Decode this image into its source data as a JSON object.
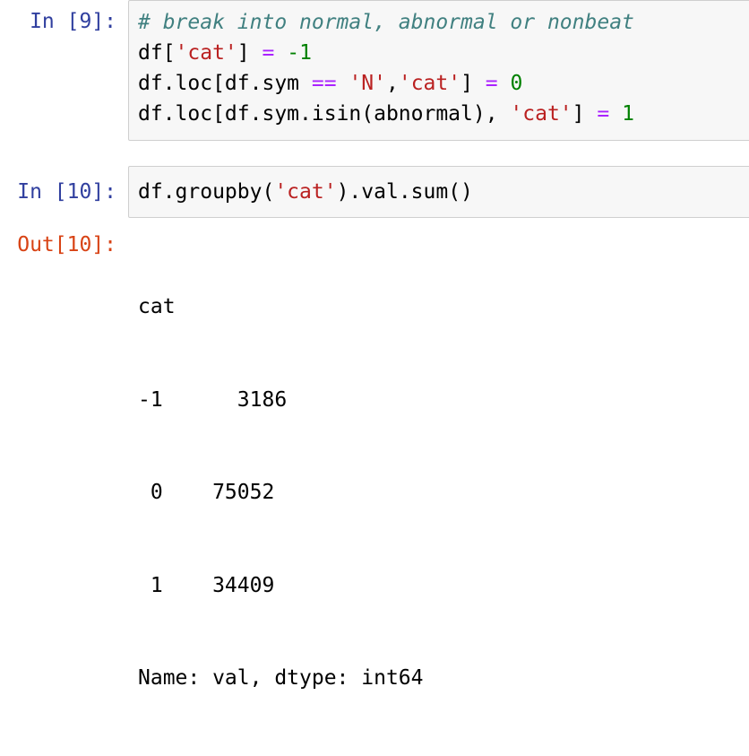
{
  "cells": [
    {
      "prompt": "In [9]:",
      "lines": [
        [
          {
            "t": "# break into normal, abnormal or nonbeat",
            "c": "comment"
          }
        ],
        [
          {
            "t": "df[",
            "c": ""
          },
          {
            "t": "'cat'",
            "c": "str"
          },
          {
            "t": "] ",
            "c": ""
          },
          {
            "t": "=",
            "c": "op"
          },
          {
            "t": " ",
            "c": ""
          },
          {
            "t": "-1",
            "c": "num"
          }
        ],
        [
          {
            "t": "df.loc[df.sym ",
            "c": ""
          },
          {
            "t": "==",
            "c": "op"
          },
          {
            "t": " ",
            "c": ""
          },
          {
            "t": "'N'",
            "c": "str"
          },
          {
            "t": ",",
            "c": ""
          },
          {
            "t": "'cat'",
            "c": "str"
          },
          {
            "t": "] ",
            "c": ""
          },
          {
            "t": "=",
            "c": "op"
          },
          {
            "t": " ",
            "c": ""
          },
          {
            "t": "0",
            "c": "num"
          }
        ],
        [
          {
            "t": "df.loc[df.sym.isin(abnormal), ",
            "c": ""
          },
          {
            "t": "'cat'",
            "c": "str"
          },
          {
            "t": "] ",
            "c": ""
          },
          {
            "t": "=",
            "c": "op"
          },
          {
            "t": " ",
            "c": ""
          },
          {
            "t": "1",
            "c": "num"
          }
        ]
      ]
    },
    {
      "prompt": "In [10]:",
      "lines": [
        [
          {
            "t": "df.groupby(",
            "c": ""
          },
          {
            "t": "'cat'",
            "c": "str"
          },
          {
            "t": ").val.sum()",
            "c": ""
          }
        ]
      ],
      "out_prompt": "Out[10]:",
      "output_lines": [
        "cat",
        "-1      3186",
        " 0    75052",
        " 1    34409",
        "Name: val, dtype: int64"
      ]
    }
  ]
}
